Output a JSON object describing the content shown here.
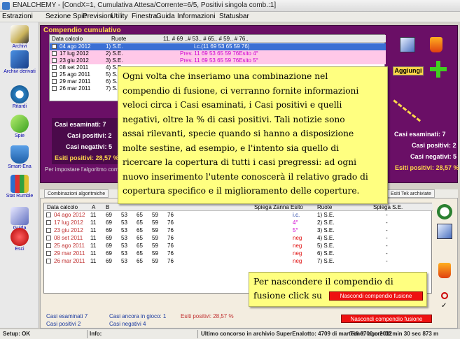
{
  "window": {
    "title": "ENALCHEMY - [CondX=1, Cumulativa Attesa/Corrente=6/5, Positivi singola comb.:1]"
  },
  "menu": [
    "Estrazioni",
    "Sezione Spie",
    "Previsioni",
    "Utility",
    "Finestra",
    "Guida",
    "Informazioni",
    "Statusbar"
  ],
  "toolbar": [
    "Archivi",
    "Archivi derivati",
    "Ritardi",
    "Spie",
    "Smart-Ena",
    "Stat Rumble",
    "Guida",
    "Esci"
  ],
  "compendio": {
    "title": "Compendio cumulativo",
    "headers": [
      "Data calcolo",
      "Ruote",
      "11. # 69 ..# 53.. # 65.. # 59.. # 76.."
    ],
    "rows": [
      {
        "date": "04 ago 2012",
        "ruote": "1) S.E.",
        "comb": "i.c.(11 69 53 65 59 76)"
      },
      {
        "date": "17 lug 2012",
        "ruote": "2) S.E.",
        "comb": "Prev. 11 69 53 65 59 76Esito 4°"
      },
      {
        "date": "23 giu 2012",
        "ruote": "3) S.E.",
        "comb": "Prev. 11 69 53 65 59 76Esito 5°"
      },
      {
        "date": "08 set 2011",
        "ruote": "4) S.E",
        "comb": ""
      },
      {
        "date": "25 ago 2011",
        "ruote": "5) S.E",
        "comb": ""
      },
      {
        "date": "29 mar 2011",
        "ruote": "6) S.E",
        "comb": ""
      },
      {
        "date": "26 mar 2011",
        "ruote": "7) S.E",
        "comb": ""
      }
    ],
    "stats_left": [
      "Casi esaminati: 7",
      "Casi positivi: 2",
      "Casi negativi: 5",
      "Esiti positivi: 28,57 %"
    ],
    "stats_right": [
      "Casi esaminati: 7",
      "Casi positivi: 2",
      "Casi negativi: 5",
      "Esiti positivi: 28,57 %"
    ],
    "aggiungi": "Aggiungi",
    "bottom_hint": "Per impostare l'algoritmo com"
  },
  "tabs": [
    "Combinazioni algoritmiche",
    "Esiti Tek archiviate"
  ],
  "lower": {
    "headers": [
      "Data calcolo",
      "A",
      "B",
      "Spiega Zanna",
      "Esito",
      "Ruote",
      "Spiega S.E."
    ],
    "rows": [
      {
        "date": "04 ago 2012",
        "n": [
          "11",
          "69",
          "53",
          "65",
          "59",
          "76"
        ],
        "esito": "i.c.",
        "ruote": "1) S.E.",
        "s": "-"
      },
      {
        "date": "17 lug 2012",
        "n": [
          "11",
          "69",
          "53",
          "65",
          "59",
          "76"
        ],
        "esito": "4°",
        "ruote": "2) S.E.",
        "s": "-"
      },
      {
        "date": "23 giu 2012",
        "n": [
          "11",
          "69",
          "53",
          "65",
          "59",
          "76"
        ],
        "esito": "5°",
        "ruote": "3) S.E.",
        "s": "-"
      },
      {
        "date": "08 set 2011",
        "n": [
          "11",
          "69",
          "53",
          "65",
          "59",
          "76"
        ],
        "esito": "neg",
        "ruote": "4) S.E.",
        "s": "-"
      },
      {
        "date": "25 ago 2011",
        "n": [
          "11",
          "69",
          "53",
          "65",
          "59",
          "76"
        ],
        "esito": "neg",
        "ruote": "5) S.E.",
        "s": "-"
      },
      {
        "date": "29 mar 2011",
        "n": [
          "11",
          "69",
          "53",
          "65",
          "59",
          "76"
        ],
        "esito": "neg",
        "ruote": "6) S.E.",
        "s": "-"
      },
      {
        "date": "26 mar 2011",
        "n": [
          "11",
          "69",
          "53",
          "65",
          "59",
          "76"
        ],
        "esito": "neg",
        "ruote": "7) S.E.",
        "s": "-"
      }
    ],
    "stats": {
      "esaminati": "Casi esaminati 7",
      "ancora": "Casi ancora in gioco: 1",
      "esiti": "Esiti positivi: 28,57 %",
      "positivi": "Casi positivi 2",
      "negativi": "Casi negativi 4"
    },
    "hide_button": "Nascondi compendio fusione"
  },
  "tooltip_main": [
    "Ogni volta che inseriamo una combinazione nel",
    "compendio di fusione, ci verranno fornite informazioni",
    "veloci circa i Casi esaminati, i Casi positivi e quelli",
    "negativi, oltre la % di casi positivi. Tali notizie sono",
    "assai rilevanti, specie quando si hanno a disposizione",
    "molte sestine, ad esempio, e l'intento sia quello di",
    "ricercare la copertura di tutti i casi pregressi: ad ogni",
    "nuovo inserimento l'utente conoscerà il relativo grado di",
    "copertura specifico e il miglioramento delle coperture."
  ],
  "tooltip_hide": [
    "Per nascondere il compendio di",
    "fusione click su"
  ],
  "statusbar": {
    "setup": "Setup: OK",
    "info": "Info:",
    "last": "Ultimo concorso in archivio SuperEnalotto: 4709 di martedì 07 ago 2012",
    "time": "Time: 00 ore 00 min 30 sec 873 m"
  }
}
